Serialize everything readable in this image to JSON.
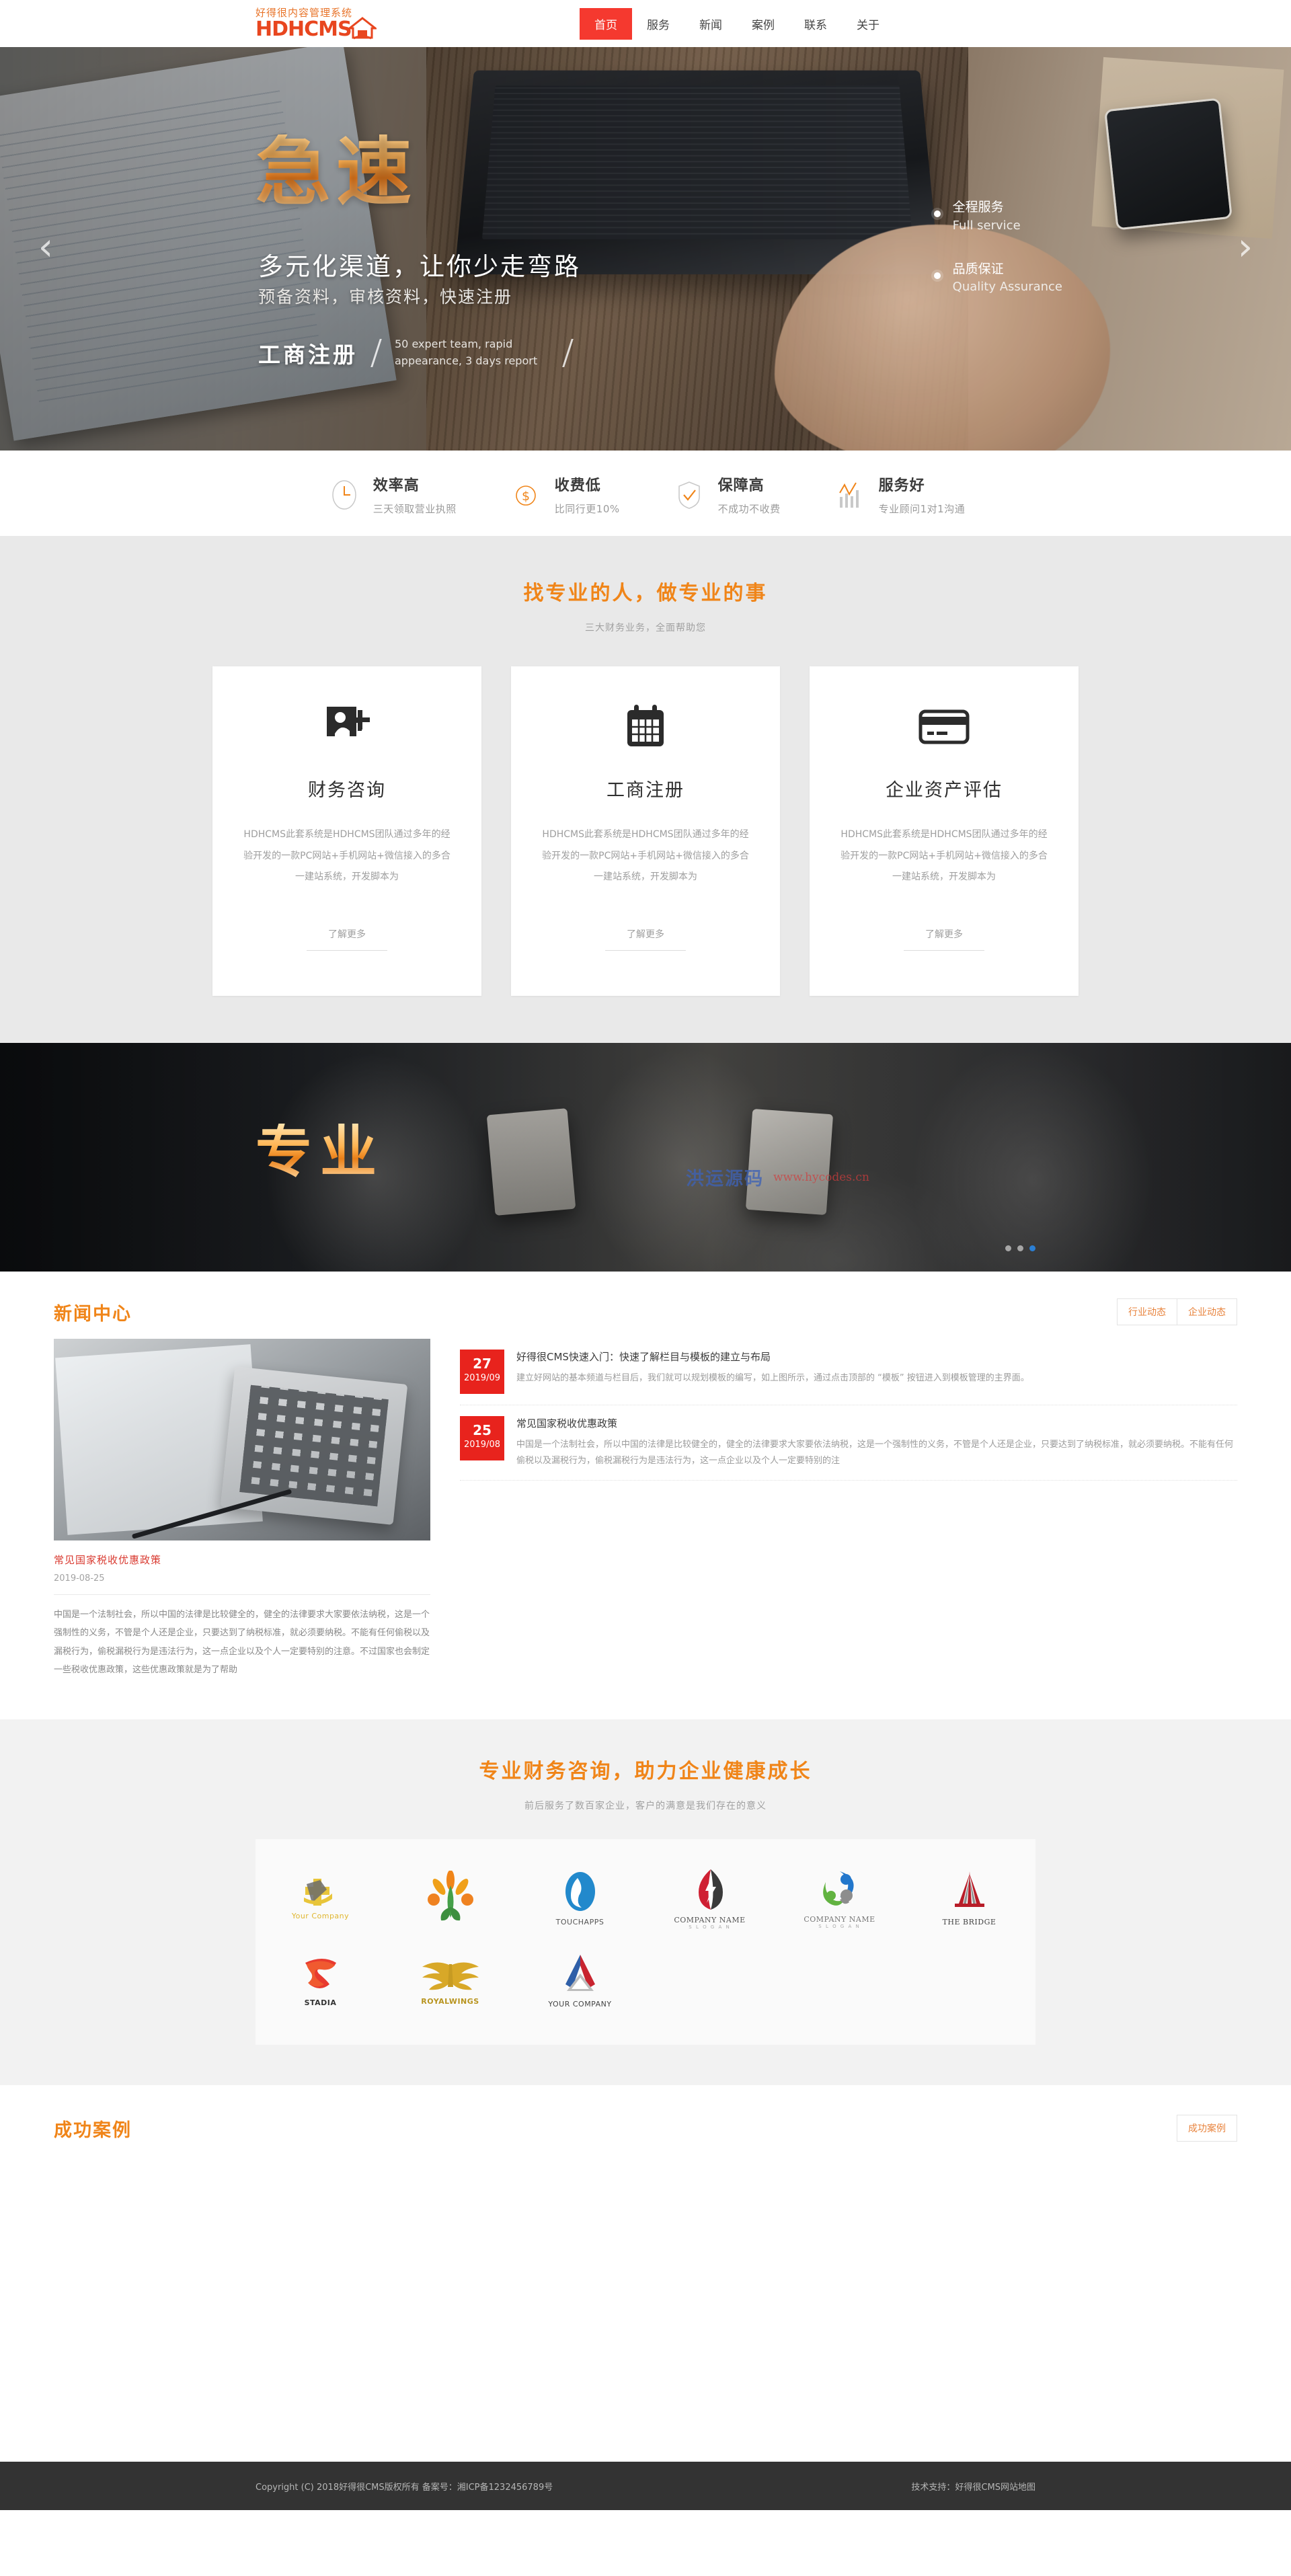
{
  "header": {
    "logo_cn": "好得很内容管理系统",
    "logo_en": "HDHCMS",
    "nav": [
      {
        "label": "首页",
        "active": true
      },
      {
        "label": "服务",
        "active": false
      },
      {
        "label": "新闻",
        "active": false
      },
      {
        "label": "案例",
        "active": false
      },
      {
        "label": "联系",
        "active": false
      },
      {
        "label": "关于",
        "active": false
      }
    ]
  },
  "hero": {
    "title": "急速",
    "sub1": "多元化渠道，让你少走弯路",
    "sub2": "预备资料，审核资料，快速注册",
    "foot_cn": "工商注册",
    "foot_en": "50 expert team, rapid appearance, 3 days report",
    "badges": [
      {
        "cn": "全程服务",
        "en": "Full service"
      },
      {
        "cn": "品质保证",
        "en": "Quality Assurance"
      }
    ],
    "arrow_left": "‹",
    "arrow_right": "›"
  },
  "features": [
    {
      "icon": "clock-icon",
      "title": "效率高",
      "desc": "三天领取营业执照"
    },
    {
      "icon": "dollar-icon",
      "title": "收费低",
      "desc": "比同行更10%"
    },
    {
      "icon": "shield-check-icon",
      "title": "保障高",
      "desc": "不成功不收费"
    },
    {
      "icon": "chart-bars-icon",
      "title": "服务好",
      "desc": "专业顾问1对1沟通"
    }
  ],
  "services": {
    "title": "找专业的人，做专业的事",
    "subtitle": "三大财务业务，全面帮助您",
    "cards": [
      {
        "icon": "google-plus-icon",
        "title": "财务咨询",
        "desc": "HDHCMS此套系统是HDHCMS团队通过多年的经验开发的一款PC网站+手机网站+微信接入的多合一建站系统，开发脚本为",
        "more": "了解更多"
      },
      {
        "icon": "calendar-icon",
        "title": "工商注册",
        "desc": "HDHCMS此套系统是HDHCMS团队通过多年的经验开发的一款PC网站+手机网站+微信接入的多合一建站系统，开发脚本为",
        "more": "了解更多"
      },
      {
        "icon": "credit-card-icon",
        "title": "企业资产评估",
        "desc": "HDHCMS此套系统是HDHCMS团队通过多年的经验开发的一款PC网站+手机网站+微信接入的多合一建站系统，开发脚本为",
        "more": "了解更多"
      }
    ]
  },
  "banner2": {
    "title": "专业",
    "watermark_cn": "洪运源码",
    "watermark_en": "www.hycodes.cn",
    "dots": 3,
    "active_dot": 2
  },
  "news": {
    "title": "新闻中心",
    "tabs": [
      {
        "label": "行业动态"
      },
      {
        "label": "企业动态"
      }
    ],
    "featured": {
      "title": "常见国家税收优惠政策",
      "date": "2019-08-25",
      "body": "中国是一个法制社会，所以中国的法律是比较健全的，健全的法律要求大家要依法纳税，这是一个强制性的义务，不管是个人还是企业，只要达到了纳税标准，就必须要纳税。不能有任何偷税以及漏税行为，偷税漏税行为是违法行为，这一点企业以及个人一定要特别的注意。不过国家也会制定一些税收优惠政策，这些优惠政策就是为了帮助"
    },
    "items": [
      {
        "day": "27",
        "month": "2019/09",
        "title": "好得很CMS快速入门：快速了解栏目与模板的建立与布局",
        "excerpt": "建立好网站的基本频道与栏目后，我们就可以规划模板的编写，如上图所示，通过点击顶部的 “模板” 按钮进入到模板管理的主界面。"
      },
      {
        "day": "25",
        "month": "2019/08",
        "title": "常见国家税收优惠政策",
        "excerpt": "中国是一个法制社会，所以中国的法律是比较健全的，健全的法律要求大家要依法纳税，这是一个强制性的义务，不管是个人还是企业，只要达到了纳税标准，就必须要纳税。不能有任何偷税以及漏税行为，偷税漏税行为是违法行为，这一点企业以及个人一定要特别的注"
      }
    ]
  },
  "partners": {
    "title": "专业财务咨询，助力企业健康成长",
    "subtitle": "前后服务了数百家企业，客户的满意是我们存在的意义",
    "logos": [
      {
        "name": "Your Company",
        "slogan": "",
        "kind": "yourcompany"
      },
      {
        "name": "",
        "slogan": "",
        "kind": "flower"
      },
      {
        "name": "TOUCHAPPS",
        "slogan": "",
        "kind": "touchapps"
      },
      {
        "name": "COMPANY NAME",
        "slogan": "S L O G A N",
        "kind": "bolt"
      },
      {
        "name": "COMPANY NAME",
        "slogan": "S L O G A N",
        "kind": "people"
      },
      {
        "name": "THE BRIDGE",
        "slogan": "",
        "kind": "bridge"
      },
      {
        "name": "STADIA",
        "slogan": "",
        "kind": "stadia"
      },
      {
        "name": "ROYALWINGS",
        "slogan": "",
        "kind": "wings"
      },
      {
        "name": "YOUR COMPANY",
        "slogan": "",
        "kind": "arrowhead"
      }
    ]
  },
  "cases": {
    "title": "成功案例",
    "tab": "成功案例"
  },
  "footer": {
    "copyright": "Copyright (C) 2018好得很CMS版权所有 备案号：湘ICP备1232456789号",
    "support_label": "技术支持：",
    "support_name": "好得很CMS",
    "sitemap": "网站地图"
  },
  "colors": {
    "brand_orange": "#f08519",
    "brand_red": "#f5392f",
    "logo_red": "#e8461f",
    "footer_bg": "#333333"
  }
}
